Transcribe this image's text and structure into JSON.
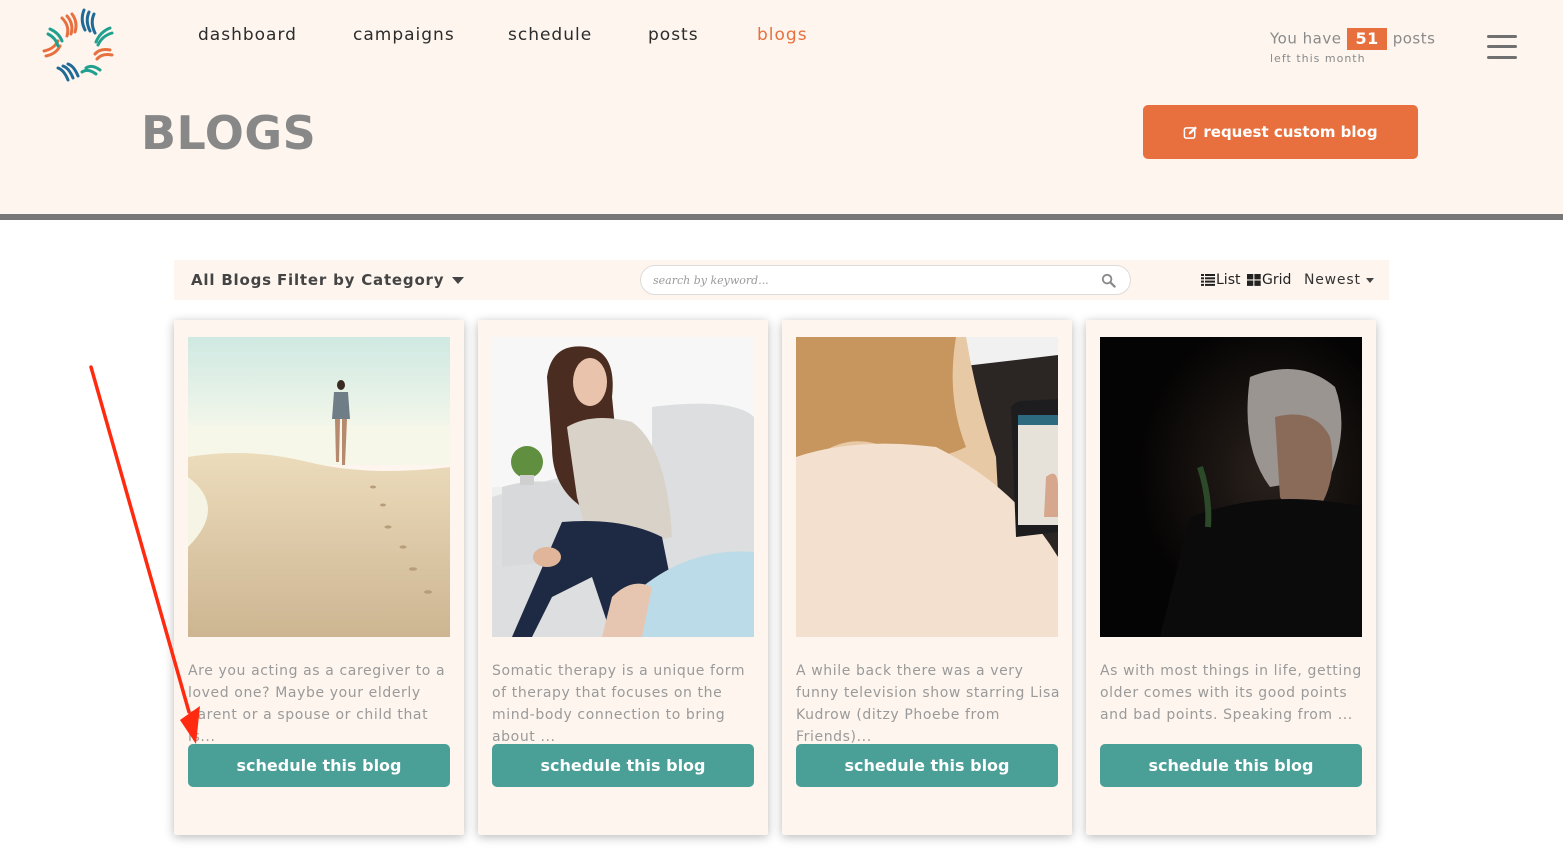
{
  "brand": {
    "logo_icon": "starburst-logo-icon",
    "accent_color": "#e8703f",
    "teal_color": "#4a9f97"
  },
  "nav": {
    "items": [
      {
        "label": "dashboard",
        "active": false
      },
      {
        "label": "campaigns",
        "active": false
      },
      {
        "label": "schedule",
        "active": false
      },
      {
        "label": "posts",
        "active": false
      },
      {
        "label": "blogs",
        "active": true
      }
    ]
  },
  "quota": {
    "prefix": "You have",
    "count": "51",
    "suffix": "posts",
    "subtitle": "left this month"
  },
  "menu_icon": "hamburger-icon",
  "page": {
    "title": "BLOGS",
    "request_button": {
      "icon": "edit-icon",
      "label": "request custom blog"
    }
  },
  "toolbar": {
    "all_blogs": "All Blogs",
    "filter_label": "Filter by Category",
    "search_placeholder": "search by keyword...",
    "search_value": "",
    "view_list": "List",
    "view_grid": "Grid",
    "sort_label": "Newest"
  },
  "blogs": [
    {
      "image": "woman walking on beach",
      "excerpt": "Are you acting as a caregiver to a loved one? Maybe your elderly parent or a spouse or child that is...",
      "button": "schedule this blog"
    },
    {
      "image": "woman seated on sofa in therapy session",
      "excerpt": "Somatic therapy is a unique form of therapy that focuses on the mind-body connection to bring about ...",
      "button": "schedule this blog"
    },
    {
      "image": "woman using laptop for video call",
      "excerpt": "A while back there was a very funny television show starring Lisa Kudrow (ditzy Phoebe from Friends)...",
      "button": "schedule this blog"
    },
    {
      "image": "elderly woman portrait in dark",
      "excerpt": "As with most things in life, getting older comes with its good points and bad points. Speaking from ...",
      "button": "schedule this blog"
    }
  ],
  "annotation": {
    "type": "red-arrow",
    "points_to": "first card excerpt / schedule button",
    "color": "#ff2a10"
  }
}
